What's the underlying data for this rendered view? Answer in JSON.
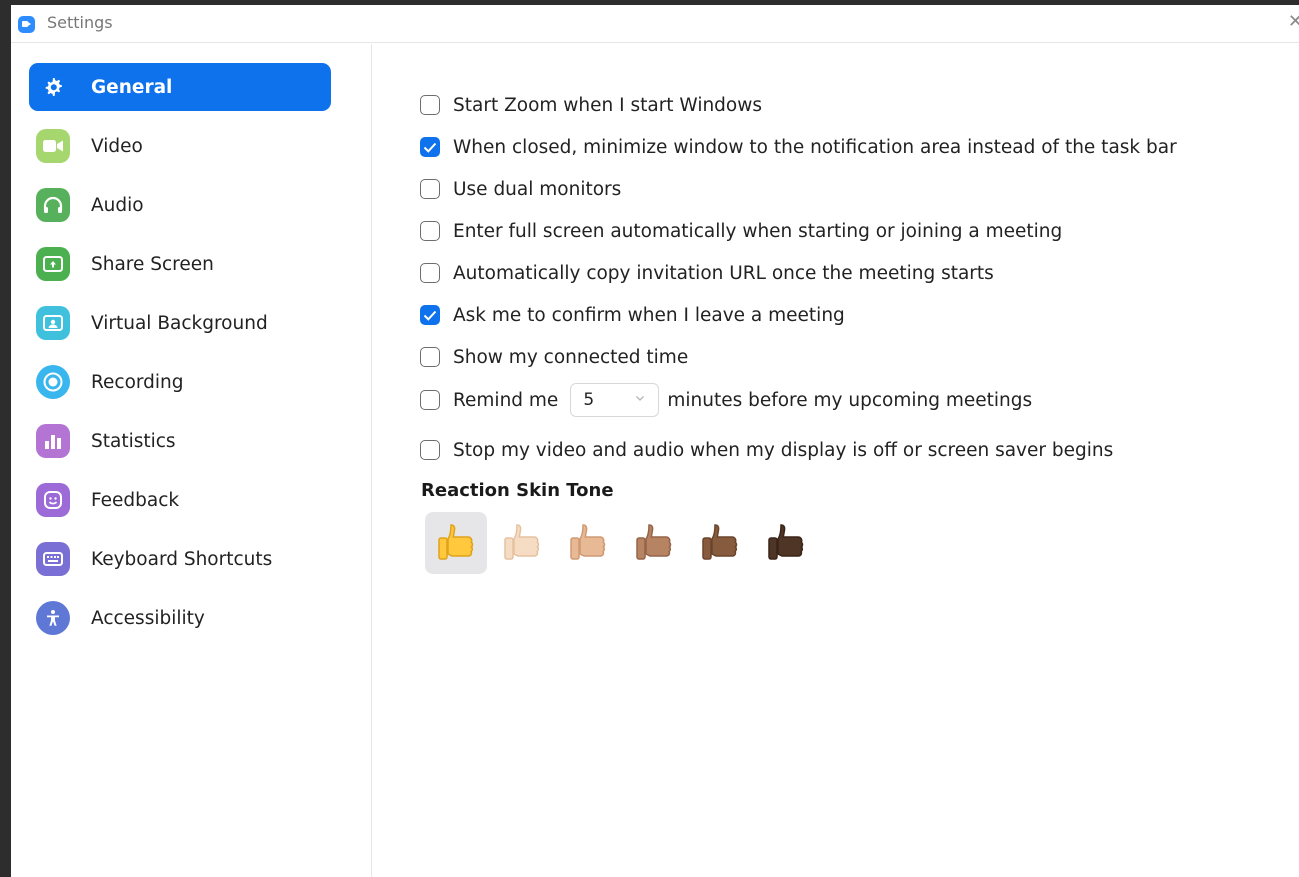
{
  "window": {
    "title": "Settings",
    "close_glyph": "✕"
  },
  "sidebar": {
    "items": [
      {
        "label": "General",
        "icon": "gear-icon",
        "color": "#0e72ed",
        "active": true
      },
      {
        "label": "Video",
        "icon": "video-camera-icon",
        "color": "#a6d76f"
      },
      {
        "label": "Audio",
        "icon": "headphones-icon",
        "color": "#57b05b"
      },
      {
        "label": "Share Screen",
        "icon": "share-screen-icon",
        "color": "#4caf50"
      },
      {
        "label": "Virtual Background",
        "icon": "virtual-background-icon",
        "color": "#3fc1dd"
      },
      {
        "label": "Recording",
        "icon": "recording-icon",
        "color": "#3ab6ef"
      },
      {
        "label": "Statistics",
        "icon": "statistics-icon",
        "color": "#b374d4"
      },
      {
        "label": "Feedback",
        "icon": "feedback-icon",
        "color": "#9c6bd7"
      },
      {
        "label": "Keyboard Shortcuts",
        "icon": "keyboard-icon",
        "color": "#7a6fd4"
      },
      {
        "label": "Accessibility",
        "icon": "accessibility-icon",
        "color": "#5f78d6"
      }
    ]
  },
  "general": {
    "options": [
      {
        "label": "Start Zoom when I start Windows",
        "checked": false
      },
      {
        "label": "When closed, minimize window to the notification area instead of the task bar",
        "checked": true
      },
      {
        "label": "Use dual monitors",
        "checked": false
      },
      {
        "label": "Enter full screen automatically when starting or joining a meeting",
        "checked": false
      },
      {
        "label": "Automatically copy invitation URL once the meeting starts",
        "checked": false
      },
      {
        "label": "Ask me to confirm when I leave a meeting",
        "checked": true
      },
      {
        "label": "Show my connected time",
        "checked": false
      }
    ],
    "remind": {
      "label_before": "Remind me",
      "value": "5",
      "label_after": "minutes before my upcoming meetings",
      "checked": false
    },
    "stop_video": {
      "label": "Stop my video and audio when my display is off or screen saver begins",
      "checked": false
    },
    "reaction_title": "Reaction Skin Tone",
    "skin_tones": [
      {
        "name": "default-yellow",
        "fill": "#ffc83d",
        "shade": "#e0a21a",
        "selected": true
      },
      {
        "name": "light",
        "fill": "#f7dcc4",
        "shade": "#e6c1a1"
      },
      {
        "name": "medium-light",
        "fill": "#e7b995",
        "shade": "#cf9a73"
      },
      {
        "name": "medium",
        "fill": "#b78463",
        "shade": "#956448"
      },
      {
        "name": "medium-dark",
        "fill": "#865b3e",
        "shade": "#6a442b"
      },
      {
        "name": "dark",
        "fill": "#4e3525",
        "shade": "#3a2518"
      }
    ]
  },
  "colors": {
    "accent": "#0e72ed",
    "text": "#222222"
  }
}
